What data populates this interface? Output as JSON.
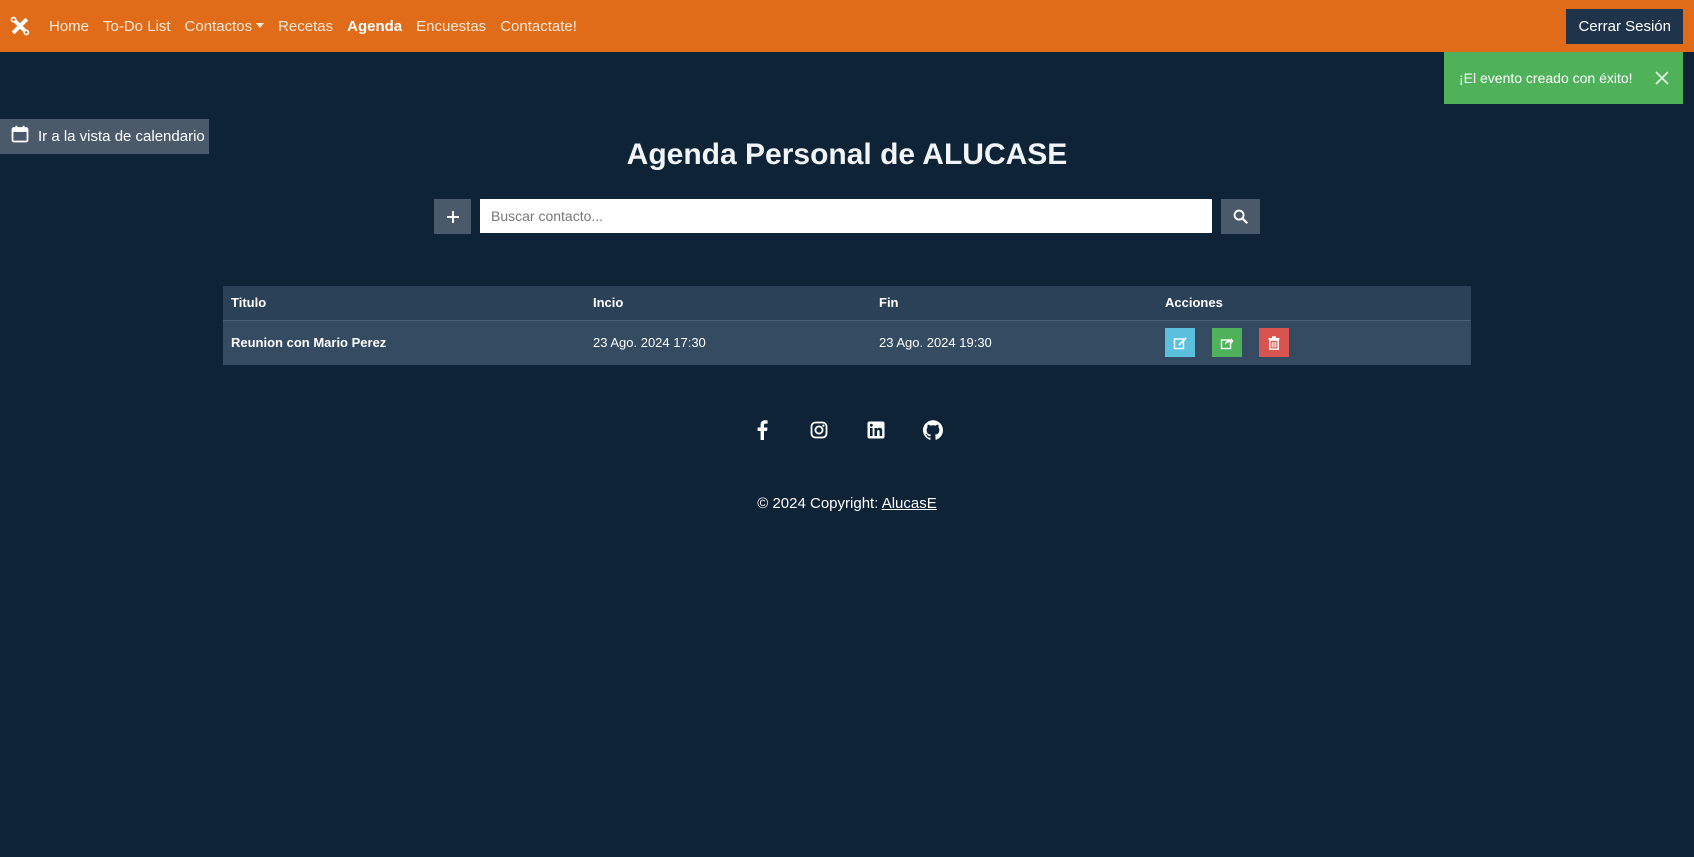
{
  "navbar": {
    "brand_icon": "tools-icon",
    "items": [
      {
        "label": "Home"
      },
      {
        "label": "To-Do List"
      },
      {
        "label": "Contactos"
      },
      {
        "label": "Recetas"
      },
      {
        "label": "Agenda"
      },
      {
        "label": "Encuestas"
      },
      {
        "label": "Contactate!"
      }
    ],
    "active": "Agenda",
    "logout_label": "Cerrar Sesión",
    "color": "#e06b18"
  },
  "toast": {
    "message": "¡El evento creado con éxito!",
    "color": "#4fb25a"
  },
  "calendar_button": {
    "label": "Ir a la vista de calendario",
    "icon": "calendar-icon"
  },
  "page": {
    "title": "Agenda Personal de ALUCASE"
  },
  "search": {
    "placeholder": "Buscar contacto...",
    "value": ""
  },
  "table": {
    "headers": [
      "Titulo",
      "Incio",
      "Fin",
      "Acciones"
    ],
    "rows": [
      {
        "title": "Reunion con Mario Perez",
        "start": "23 Ago. 2024 17:30",
        "end": "23 Ago. 2024 19:30"
      }
    ],
    "action_colors": {
      "edit": "#5bc0de",
      "share": "#4fb25a",
      "delete": "#d9534f"
    }
  },
  "footer": {
    "social": [
      "facebook-icon",
      "instagram-icon",
      "linkedin-icon",
      "github-icon"
    ],
    "copyright_text": "© 2024 Copyright: ",
    "copyright_link": "AlucasE"
  }
}
